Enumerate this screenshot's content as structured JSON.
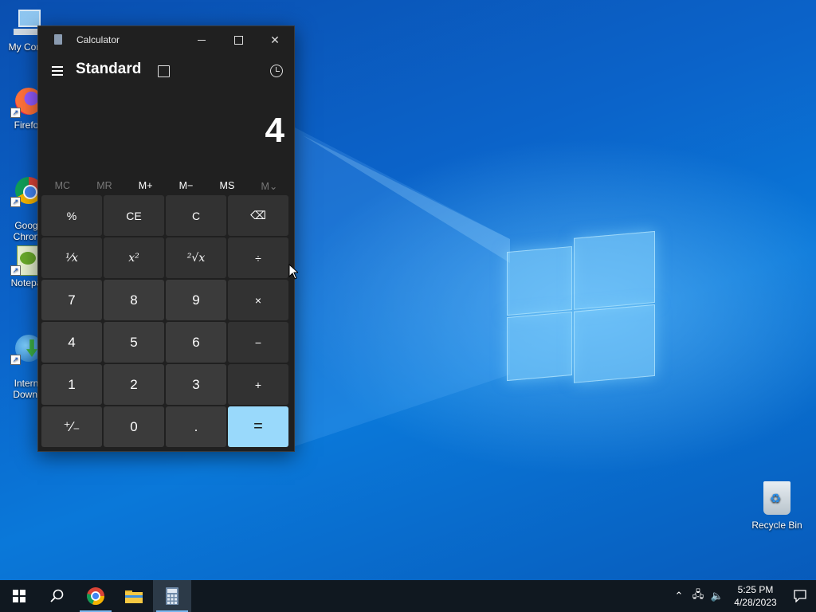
{
  "desktop": {
    "icons": [
      {
        "label": "My Com"
      },
      {
        "label": "Firefo"
      },
      {
        "label": "Goog\nChron"
      },
      {
        "label": "Notepa"
      },
      {
        "label": "Intern\nDownl"
      }
    ],
    "recycle_bin": {
      "label": "Recycle Bin"
    }
  },
  "calculator": {
    "window_title": "Calculator",
    "mode": "Standard",
    "display_value": "4",
    "memory": [
      {
        "label": "MC",
        "enabled": false
      },
      {
        "label": "MR",
        "enabled": false
      },
      {
        "label": "M+",
        "enabled": true
      },
      {
        "label": "M−",
        "enabled": true
      },
      {
        "label": "MS",
        "enabled": true
      },
      {
        "label": "M⌄",
        "enabled": false
      }
    ],
    "keys": {
      "percent": "%",
      "ce": "CE",
      "c": "C",
      "backspace": "⌫",
      "reciprocal": "¹⁄x",
      "square": "x²",
      "sqrt": "²√x",
      "divide": "÷",
      "seven": "7",
      "eight": "8",
      "nine": "9",
      "multiply": "×",
      "four": "4",
      "five": "5",
      "six": "6",
      "subtract": "−",
      "one": "1",
      "two": "2",
      "three": "3",
      "add": "+",
      "negate": "⁺∕₋",
      "zero": "0",
      "decimal": ".",
      "equals": "="
    }
  },
  "taskbar": {
    "time": "5:25 PM",
    "date": "4/28/2023"
  },
  "colors": {
    "accent": "#99d9fb",
    "taskbar": "#101820",
    "calc_bg": "#202020"
  }
}
